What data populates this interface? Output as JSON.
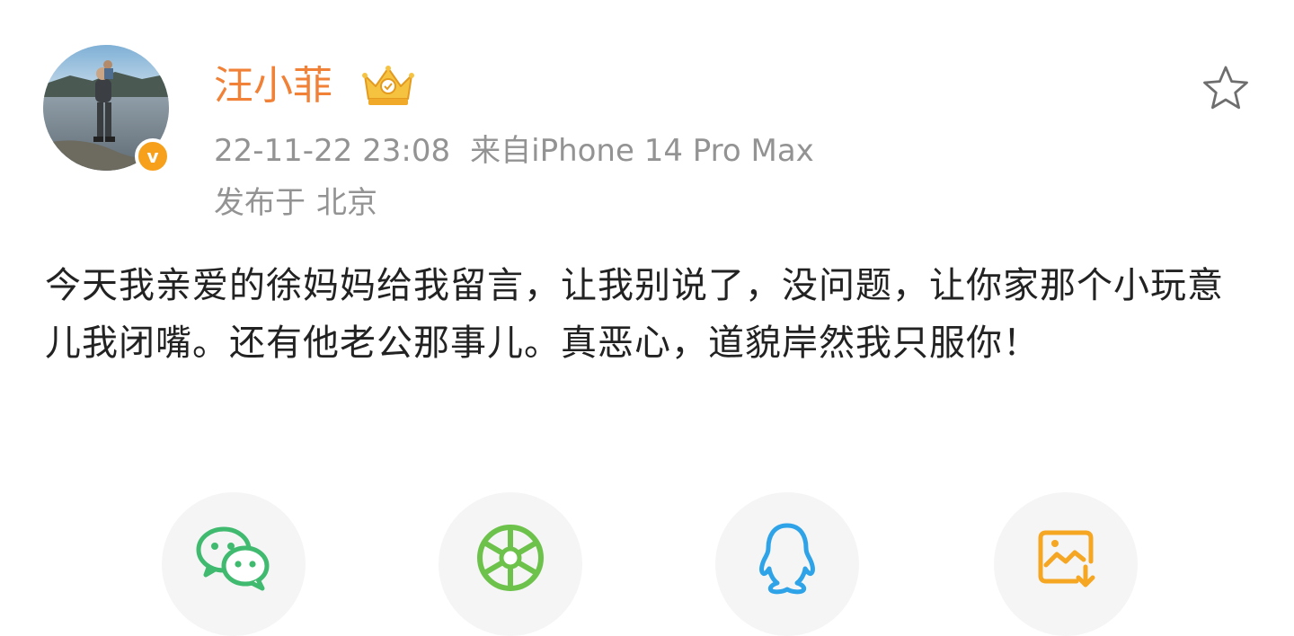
{
  "post": {
    "author": {
      "name": "汪小菲",
      "avatar_icon": "avatar-photo",
      "verified_icon": "verified-v-badge-icon",
      "verified_glyph": "v",
      "member_icon": "crown-icon"
    },
    "time": "22-11-22 23:08",
    "source": "来自iPhone 14 Pro Max",
    "location_label": "发布于",
    "location": "北京",
    "content": "今天我亲爱的徐妈妈给我留言，让我别说了，没问题，让你家那个小玩意儿我闭嘴。还有他老公那事儿。真恶心，道貌岸然我只服你！",
    "favorite_icon": "star-icon"
  },
  "share": [
    {
      "name": "wechat",
      "icon": "wechat-icon",
      "color": "#3fba6f"
    },
    {
      "name": "moments",
      "icon": "moments-icon",
      "color": "#6cc24a"
    },
    {
      "name": "qq",
      "icon": "qq-icon",
      "color": "#2fa3e8"
    },
    {
      "name": "save-image",
      "icon": "save-image-icon",
      "color": "#f5a623"
    }
  ],
  "colors": {
    "username": "#f08136",
    "meta": "#939393",
    "text": "#222222",
    "badge": "#f7a01b"
  }
}
